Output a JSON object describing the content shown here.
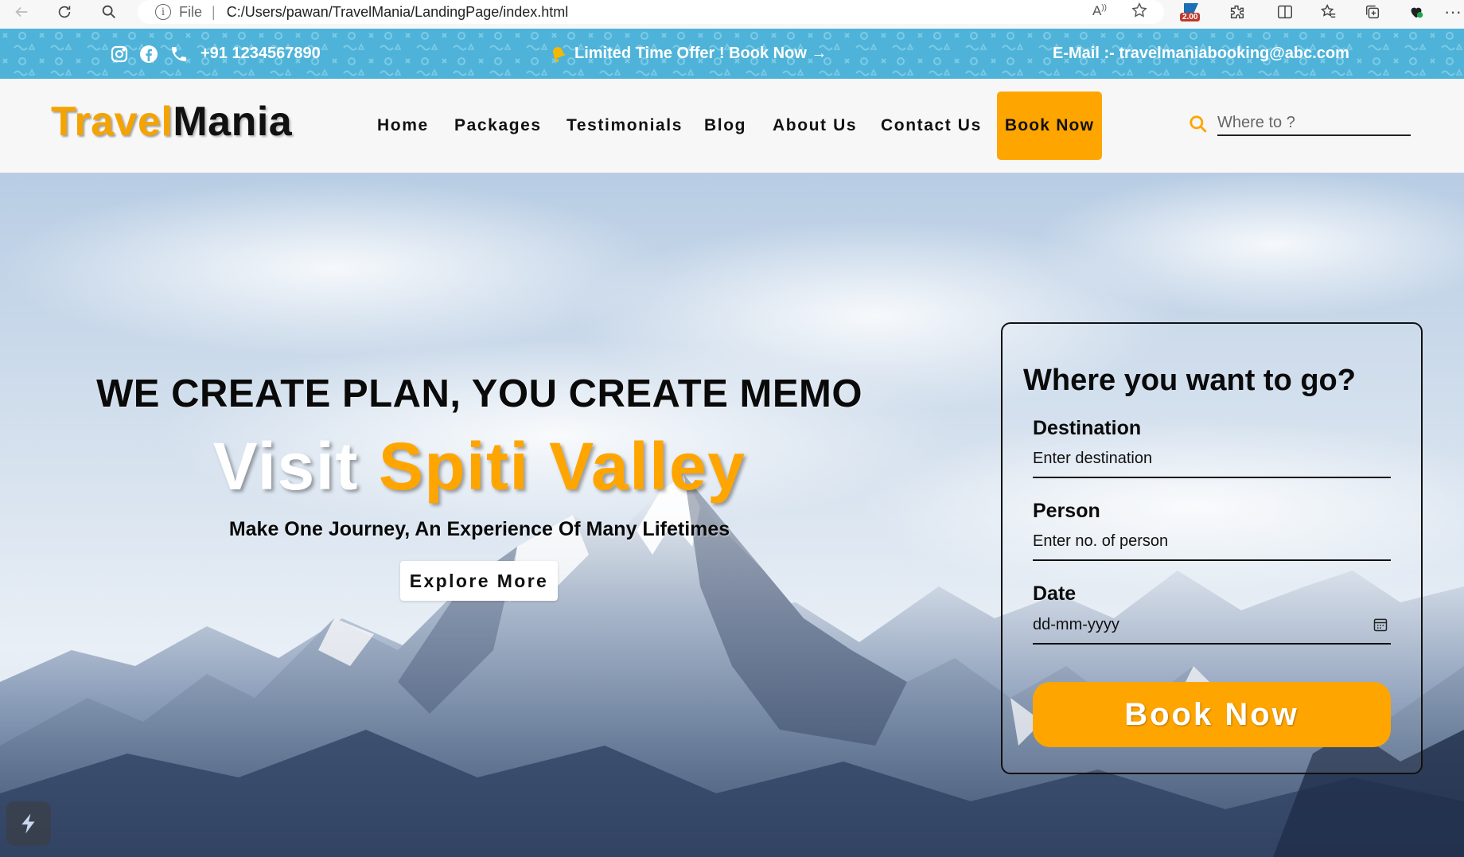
{
  "browser": {
    "scheme": "File",
    "url": "C:/Users/pawan/TravelMania/LandingPage/index.html",
    "zoom_badge": "2.00"
  },
  "topbar": {
    "phone": "+91 1234567890",
    "offer": "Limited Time Offer ! Book Now →",
    "email": "E-Mail :- travelmaniabooking@abc.com",
    "icons": [
      "instagram-icon",
      "facebook-icon",
      "phone-icon",
      "bell-icon"
    ],
    "bg_color": "#4fb3d9"
  },
  "nav": {
    "logo_part1": "Travel",
    "logo_part2": "Mania",
    "links": [
      "Home",
      "Packages",
      "Testimonials",
      "Blog",
      "About Us",
      "Contact Us"
    ],
    "book_label": "Book Now",
    "search_placeholder": "Where to ?",
    "accent_color": "#ffa500"
  },
  "hero": {
    "title": "WE CREATE PLAN, YOU CREATE MEMO",
    "visit_word": "Visit",
    "destination": "Spiti Valley",
    "subtitle": "Make One Journey, An Experience Of Many Lifetimes",
    "explore_label": "Explore More"
  },
  "booking": {
    "title": "Where you want to go?",
    "destination_label": "Destination",
    "destination_placeholder": "Enter destination",
    "person_label": "Person",
    "person_placeholder": "Enter no. of person",
    "date_label": "Date",
    "date_placeholder": "dd-mm-yyyy",
    "submit_label": "Book Now"
  }
}
